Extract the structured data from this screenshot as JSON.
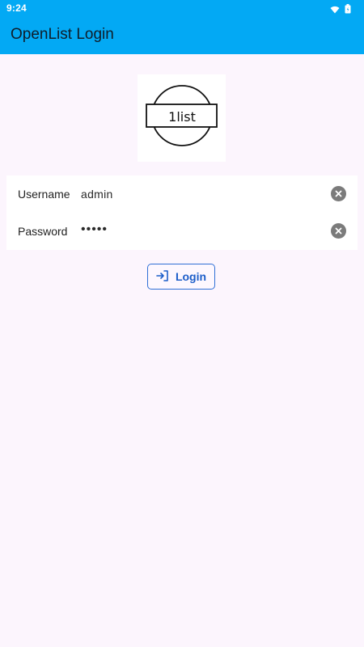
{
  "status": {
    "time": "9:24"
  },
  "appbar": {
    "title": "OpenList Login"
  },
  "logo": {
    "text": "1list"
  },
  "form": {
    "username_label": "Username",
    "username_value": "admin",
    "password_label": "Password",
    "password_value": "•••••"
  },
  "actions": {
    "login_label": "Login"
  },
  "colors": {
    "accent": "#03a9f4",
    "button": "#1d5ec9",
    "background": "#fcf5fd"
  },
  "icons": [
    "wifi-icon",
    "battery-icon",
    "clear-icon",
    "login-icon"
  ]
}
